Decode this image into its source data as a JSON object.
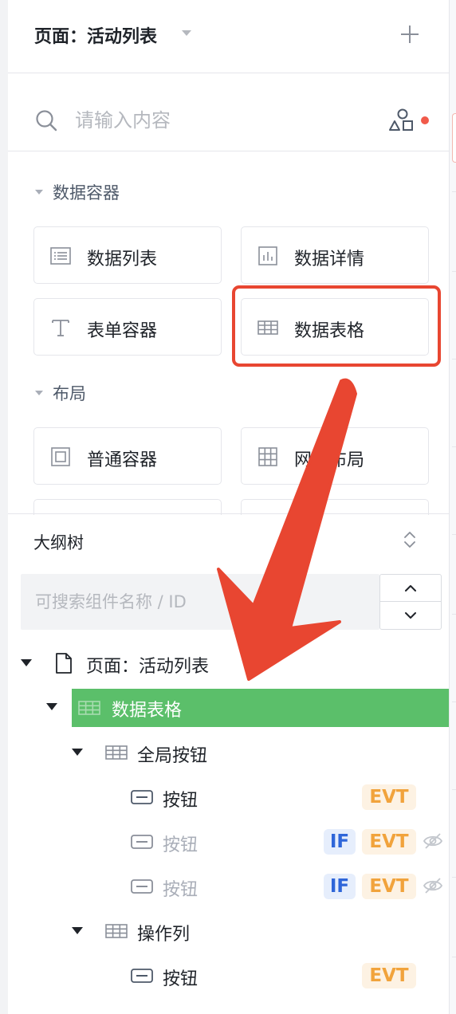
{
  "header": {
    "page_title": "页面：活动列表",
    "title_dropdown_icon": "caret-down-icon",
    "add_icon": "plus-icon"
  },
  "search": {
    "placeholder": "请输入内容",
    "search_icon": "search-icon",
    "shapes_icon": "shapes-icon",
    "notification_dot_color": "#f15a4a"
  },
  "sections": [
    {
      "title": "数据容器",
      "items": [
        {
          "label": "数据列表",
          "icon": "list-icon"
        },
        {
          "label": "数据详情",
          "icon": "bar-chart-icon"
        },
        {
          "label": "表单容器",
          "icon": "text-t-icon"
        },
        {
          "label": "数据表格",
          "icon": "table-icon"
        }
      ]
    },
    {
      "title": "布局",
      "items": [
        {
          "label": "普通容器",
          "icon": "container-icon"
        },
        {
          "label": "网格布局",
          "icon": "grid-icon"
        }
      ]
    }
  ],
  "outline": {
    "title": "大纲树",
    "collapse_icon": "expand-collapse-icon",
    "search_placeholder": "可搜索组件名称 / ID",
    "tree": [
      {
        "label": "页面：活动列表",
        "icon": "page-icon"
      },
      {
        "label": "数据表格",
        "icon": "table-icon",
        "selected": true
      },
      {
        "label": "全局按钮",
        "icon": "table-icon"
      },
      {
        "label": "按钮",
        "icon": "button-icon",
        "badges": [
          "EVT"
        ]
      },
      {
        "label": "按钮",
        "icon": "button-icon",
        "badges": [
          "IF",
          "EVT"
        ],
        "hidden": true
      },
      {
        "label": "按钮",
        "icon": "button-icon",
        "badges": [
          "IF",
          "EVT"
        ],
        "hidden": true
      },
      {
        "label": "操作列",
        "icon": "table-icon"
      },
      {
        "label": "按钮",
        "icon": "button-icon",
        "badges": [
          "EVT"
        ]
      }
    ]
  },
  "colors": {
    "highlight_red": "#e84631",
    "selected_green": "#5bbf6a",
    "evt_badge": "#f1a33c",
    "if_badge": "#2f66d9"
  }
}
